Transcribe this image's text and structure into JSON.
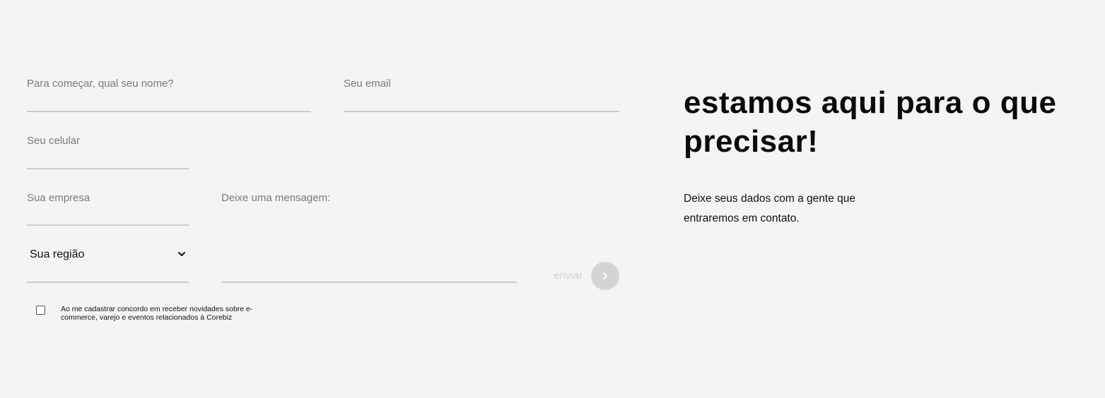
{
  "form": {
    "name_label": "Para começar, qual seu nome?",
    "email_label": "Seu email",
    "phone_label": "Seu celular",
    "company_label": "Sua empresa",
    "message_label": "Deixe uma mensagem:",
    "region_value": "Sua região",
    "submit_label": "enviar",
    "consent_text": "Ao me cadastrar concordo em receber novidades sobre e-commerce, varejo e eventos relacionados à Corebiz",
    "consent_checked": false
  },
  "intro": {
    "headline": "estamos aqui para o que precisar!",
    "subtext": "Deixe seus dados com a gente que entraremos em contato."
  },
  "icons": {
    "region_dropdown": "chevron-down-icon",
    "submit": "chevron-right-icon"
  },
  "colors": {
    "background": "#f4f4f4",
    "label": "#7a7a7a",
    "underline": "#cccccc",
    "submit_button": "#d4d4d4",
    "headline": "#0a0a0a"
  }
}
